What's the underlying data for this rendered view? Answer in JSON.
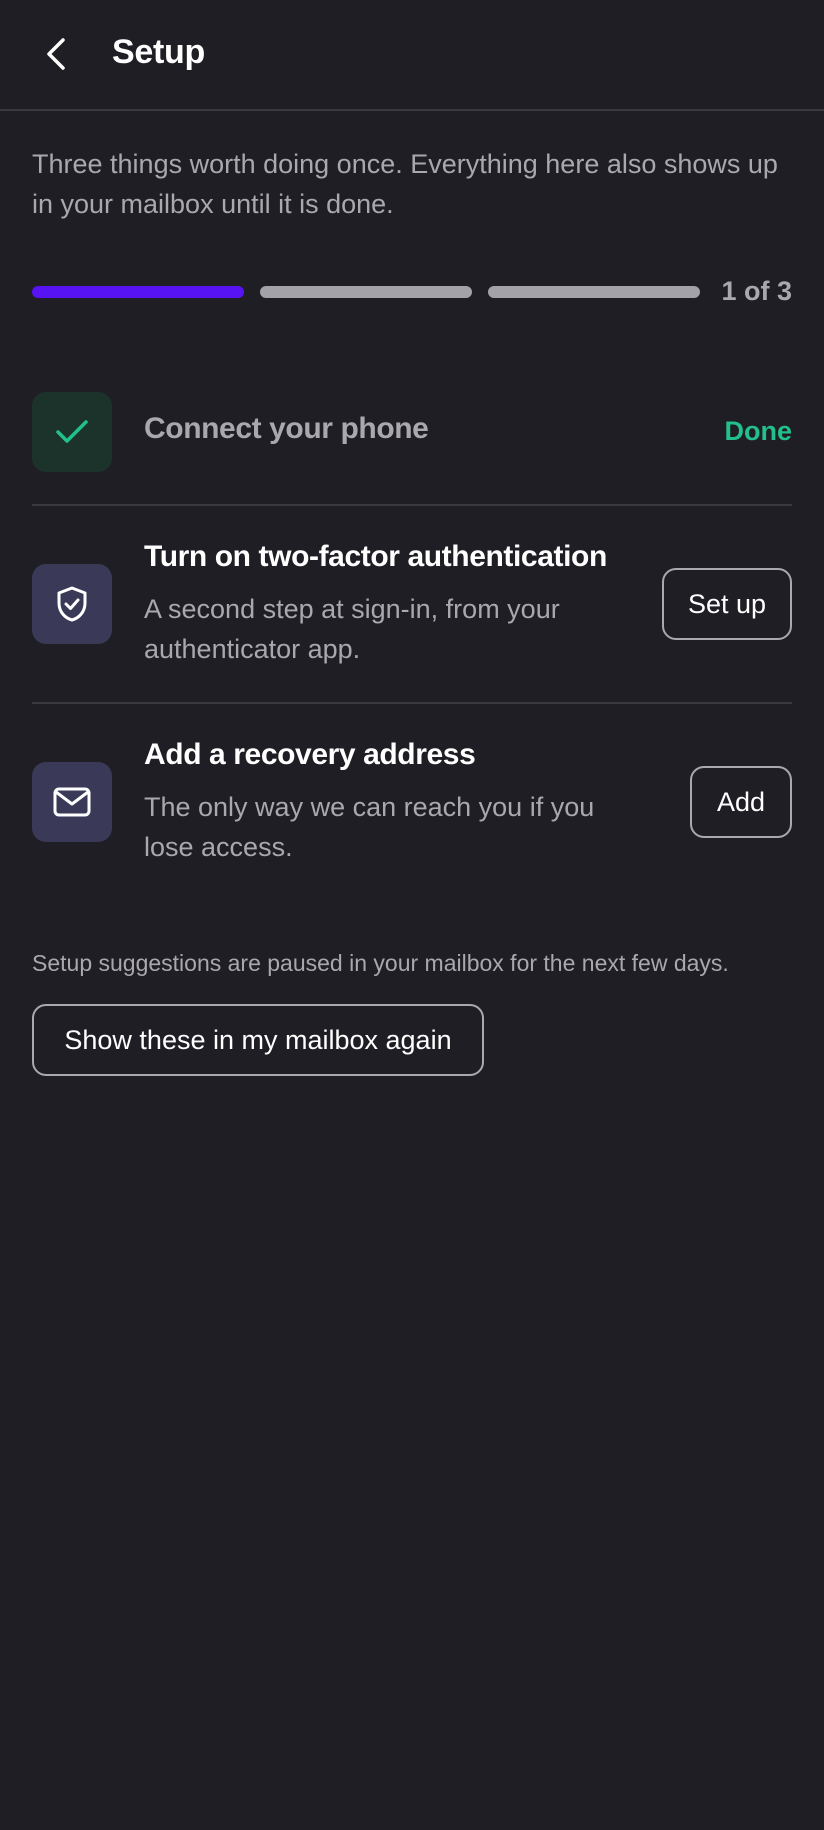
{
  "header": {
    "title": "Setup",
    "back_icon": "chevron-left-icon"
  },
  "intro": "Three things worth doing once. Everything here also shows up in your mailbox until it is done.",
  "progress": {
    "completed": 1,
    "total": 3,
    "label": "1 of 3",
    "active_color": "#5713f3",
    "inactive_color": "#a3a2a8"
  },
  "tasks": [
    {
      "icon": "check-icon",
      "title": "Connect your phone",
      "status": "Done",
      "done": true
    },
    {
      "icon": "shield-check-icon",
      "title": "Turn on two-factor authentication",
      "description": "A second step at sign-in, from your authenticator app.",
      "action_label": "Set up",
      "done": false
    },
    {
      "icon": "mail-icon",
      "title": "Add a recovery address",
      "description": "The only way we can reach you if you lose access.",
      "action_label": "Add",
      "done": false
    }
  ],
  "paused_note": "Setup suggestions are paused in your mailbox for the next few days.",
  "show_again_label": "Show these in my mailbox again",
  "colors": {
    "background": "#1f1e24",
    "success": "#22c08a",
    "muted_text": "#a9a8ae"
  }
}
